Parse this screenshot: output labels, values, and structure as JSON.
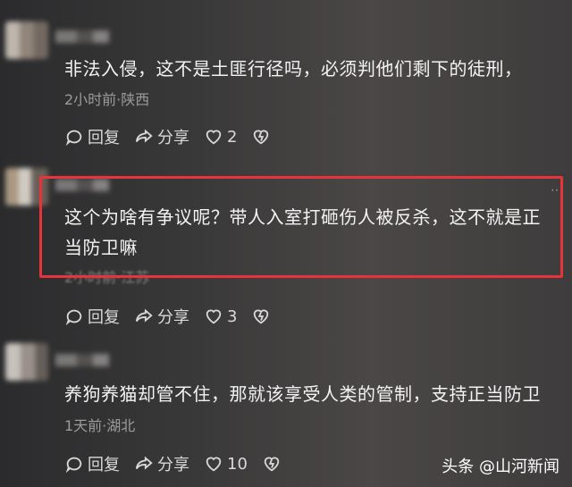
{
  "comments": [
    {
      "text": "非法入侵，这不是土匪行径吗，必须判他们剩下的徒刑，",
      "meta": "2小时前·陕西",
      "reply_label": "回复",
      "share_label": "分享",
      "like_count": "2"
    },
    {
      "text": "这个为啥有争议呢？带人入室打砸伤人被反杀，这不就是正当防卫嘛",
      "meta": "2小时前·江苏",
      "reply_label": "回复",
      "share_label": "分享",
      "like_count": "3"
    },
    {
      "text": "养狗养猫却管不住，那就该享受人类的管制，支持正当防卫",
      "meta": "1天前·湖北",
      "reply_label": "回复",
      "share_label": "分享",
      "like_count": "10"
    }
  ],
  "more_label": "··",
  "watermark": "头条 @山河新闻",
  "colors": {
    "highlight": "#e8333a",
    "meta": "#9d9b99",
    "text": "#f3f3f3"
  },
  "icons": [
    "reply-icon",
    "share-icon",
    "like-icon",
    "dislike-icon"
  ]
}
